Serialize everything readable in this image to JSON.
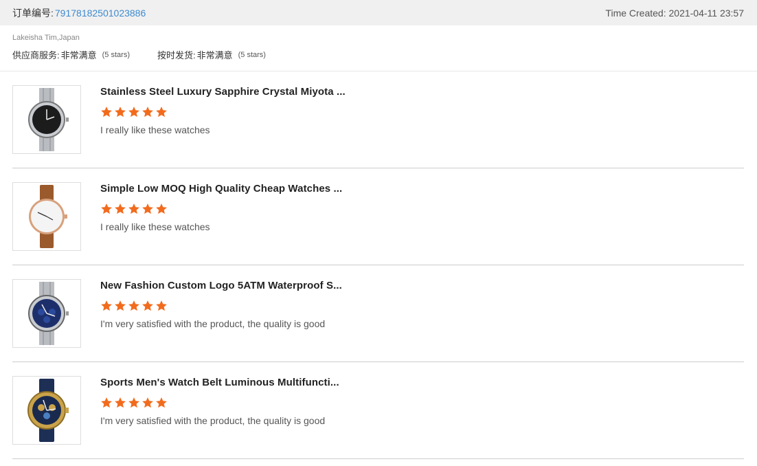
{
  "header": {
    "order_label": "订单编号:",
    "order_number": "79178182501023886",
    "time_label": "Time Created:",
    "time_value": "2021-04-11 23:57"
  },
  "buyer": "Lakeisha Tim,Japan",
  "ratings": [
    {
      "label": "供应商服务:",
      "value": "非常满意",
      "stars": "(5 stars)"
    },
    {
      "label": "按时发货:",
      "value": "非常满意",
      "stars": "(5 stars)"
    }
  ],
  "colors": {
    "star": "#f26b1d",
    "link": "#3d8ad0"
  },
  "items": [
    {
      "title": "Stainless Steel Luxury Sapphire Crystal Miyota ...",
      "rating": 5,
      "comment": "I really like these watches",
      "image_icon": "watch-steel-black-dial"
    },
    {
      "title": "Simple Low MOQ High Quality Cheap Watches ...",
      "rating": 5,
      "comment": "I really like these watches",
      "image_icon": "watch-leather-white-dial"
    },
    {
      "title": "New Fashion Custom Logo 5ATM Waterproof S...",
      "rating": 5,
      "comment": "I'm very satisfied with the product, the quality is good",
      "image_icon": "watch-steel-blue-dial"
    },
    {
      "title": "Sports Men's Watch Belt Luminous Multifuncti...",
      "rating": 5,
      "comment": "I'm very satisfied with the product, the quality is good",
      "image_icon": "watch-gold-blue-dial"
    }
  ]
}
